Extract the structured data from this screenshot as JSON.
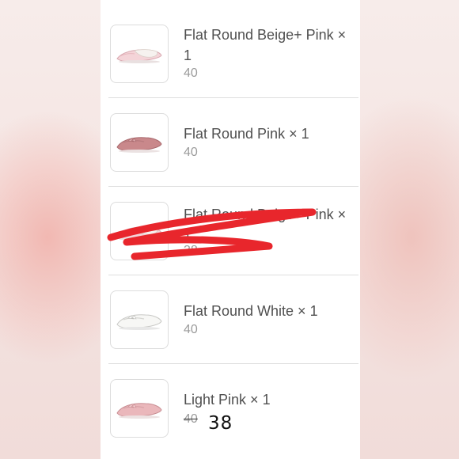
{
  "items": [
    {
      "title": "Flat Round Beige+ Pink × 1",
      "size": "40",
      "thumb_icon": "beige-pink-flat-shoe-icon"
    },
    {
      "title": "Flat Round Pink × 1",
      "size": "40",
      "thumb_icon": "pink-flat-shoe-icon"
    },
    {
      "title": "Flat Round Beige+ Pink × 1",
      "size": "38",
      "thumb_icon": "beige-pink-flat-shoe-icon"
    },
    {
      "title": "Flat Round White × 1",
      "size": "40",
      "thumb_icon": "white-flat-shoe-icon"
    },
    {
      "title": "Light Pink × 1",
      "size": "40",
      "corrected_size": "38",
      "thumb_icon": "light-pink-flat-shoe-icon"
    }
  ],
  "colors": {
    "scribble": "#e8262c",
    "text": "#505050",
    "secondary_text": "#9b9b9b",
    "divider": "#dedede"
  }
}
